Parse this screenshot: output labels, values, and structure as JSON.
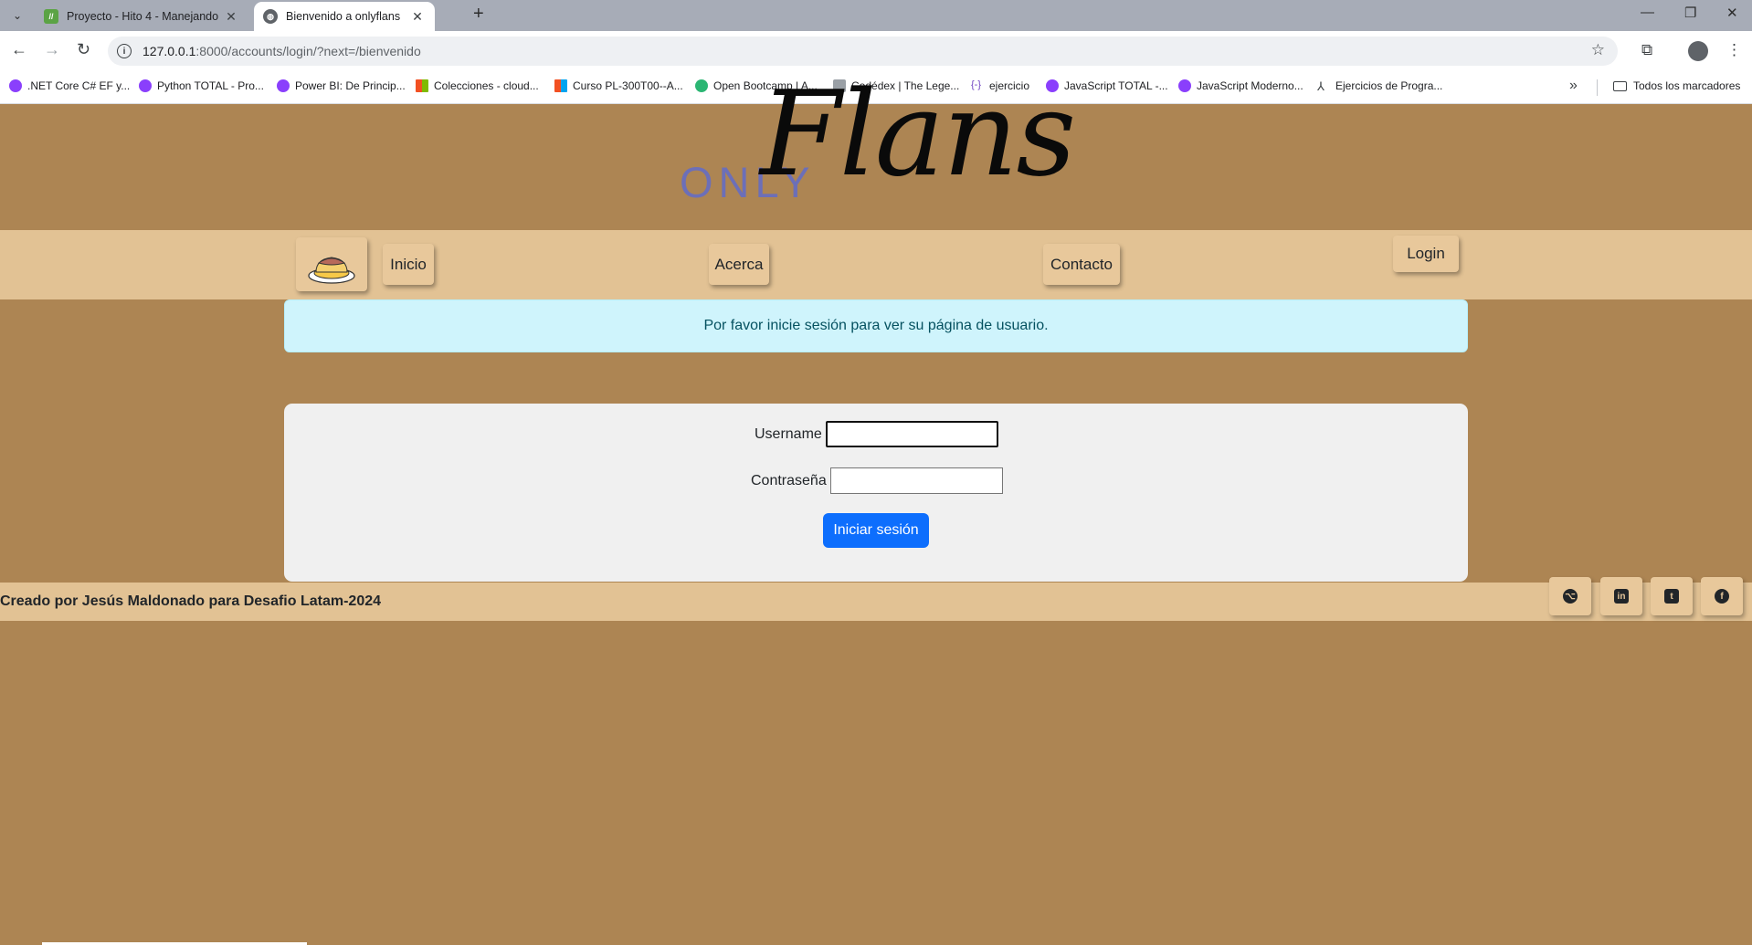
{
  "browser": {
    "tabs": [
      {
        "title": "Proyecto - Hito 4 - Manejando",
        "favicon_color": "#5ba345",
        "active": false
      },
      {
        "title": "Bienvenido a onlyflans",
        "favicon_color": "#5f6368",
        "active": true
      }
    ],
    "url_host": "127.0.0.1",
    "url_path": ":8000/accounts/login/?next=/bienvenido",
    "bookmarks": [
      {
        "label": ".NET Core C# EF y...",
        "color": "#8a3ffc"
      },
      {
        "label": "Python TOTAL - Pro...",
        "color": "#8a3ffc"
      },
      {
        "label": "Power BI: De Princip...",
        "color": "#8a3ffc"
      },
      {
        "label": "Colecciones - cloud...",
        "color": "#f25022"
      },
      {
        "label": "Curso PL-300T00--A...",
        "color": "#f25022"
      },
      {
        "label": "Open Bootcamp | A...",
        "color": "#2bb673"
      },
      {
        "label": "Codédex | The Lege...",
        "color": "#9aa0a6"
      },
      {
        "label": "ejercicio",
        "color": "#6f42c1"
      },
      {
        "label": "JavaScript TOTAL -...",
        "color": "#8a3ffc"
      },
      {
        "label": "JavaScript Moderno...",
        "color": "#8a3ffc"
      },
      {
        "label": "Ejercicios de Progra...",
        "color": "#3c4043"
      }
    ],
    "all_bookmarks_label": "Todos los marcadores"
  },
  "site": {
    "logo_only": "ONLY",
    "logo_flans": "Flans",
    "nav": {
      "inicio": "Inicio",
      "acerca": "Acerca",
      "contacto": "Contacto",
      "login": "Login"
    },
    "alert": "Por favor inicie sesión para ver su página de usuario.",
    "form": {
      "username_label": "Username",
      "username_value": "",
      "password_label": "Contraseña",
      "password_value": "",
      "submit_label": "Iniciar sesión"
    },
    "footer": {
      "credit": "Creado por Jesús Maldonado para Desafio Latam-2024",
      "social": [
        "github-icon",
        "linkedin-icon",
        "twitter-icon",
        "facebook-icon"
      ]
    }
  }
}
